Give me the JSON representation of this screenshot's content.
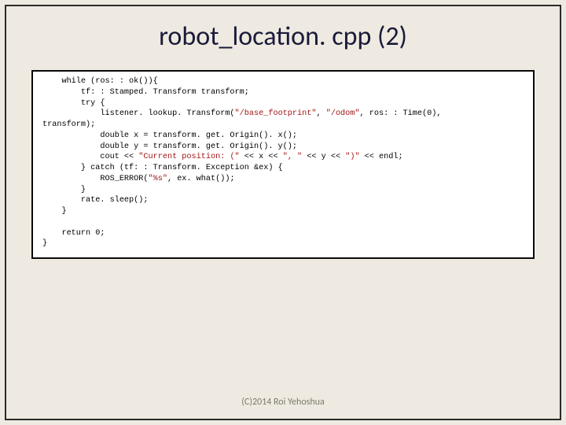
{
  "title": "robot_location. cpp (2)",
  "code": {
    "l1": "    while (ros: : ok()){",
    "l2": "        tf: : Stamped. Transform transform;",
    "l3": "        try {",
    "l4a": "            listener. lookup. Transform(",
    "l4s1": "\"/base_footprint\"",
    "l4b": ", ",
    "l4s2": "\"/odom\"",
    "l4c": ", ros: : Time(0),",
    "l5": "transform);",
    "l6": "            double x = transform. get. Origin(). x();",
    "l7": "            double y = transform. get. Origin(). y();",
    "l8a": "            cout << ",
    "l8s1": "\"Current position: (\"",
    "l8b": " << x << ",
    "l8s2": "\", \"",
    "l8c": " << y << ",
    "l8s3": "\")\"",
    "l8d": " << endl;",
    "l9": "        } catch (tf: : Transform. Exception &ex) {",
    "l10a": "            ROS_ERROR(",
    "l10s": "\"%s\"",
    "l10b": ", ex. what());",
    "l11": "        }",
    "l12": "        rate. sleep();",
    "l13": "    }",
    "blank": "",
    "l14": "    return 0;",
    "l15": "}"
  },
  "footer": "(C)2014 Roi Yehoshua"
}
